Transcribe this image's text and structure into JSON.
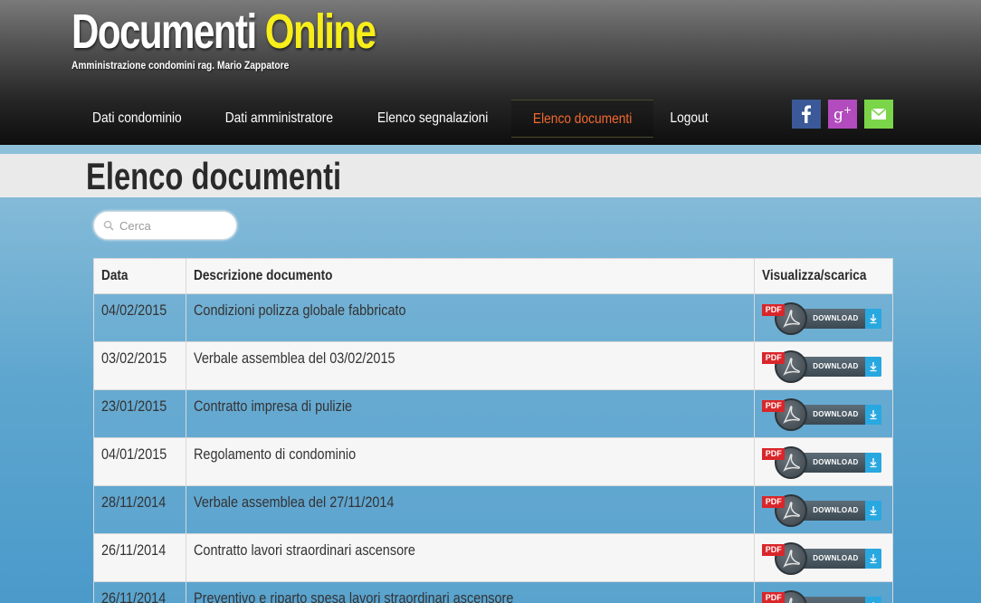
{
  "header": {
    "logo_main": "Documenti",
    "logo_accent": "Online",
    "tagline": "Amministrazione condomini rag. Mario Zappatore"
  },
  "nav": {
    "items": [
      {
        "label": "Dati condominio"
      },
      {
        "label": "Dati amministratore"
      },
      {
        "label": "Elenco segnalazioni"
      },
      {
        "label": "Elenco documenti",
        "active": true
      },
      {
        "label": "Logout"
      }
    ]
  },
  "social": {
    "icons": [
      "facebook-icon",
      "google-plus-icon",
      "mail-icon"
    ],
    "colors": {
      "facebook": "#3b5998",
      "google_plus": "#b24bbd",
      "mail": "#7bd548"
    }
  },
  "page": {
    "title": "Elenco documenti"
  },
  "search": {
    "placeholder": "Cerca",
    "value": ""
  },
  "table": {
    "headers": {
      "date": "Data",
      "description": "Descrizione documento",
      "download": "Visualizza/scarica"
    },
    "download_label": "DOWNLOAD",
    "pdf_label": "PDF",
    "rows": [
      {
        "date": "04/02/2015",
        "description": "Condizioni polizza globale fabbricato"
      },
      {
        "date": "03/02/2015",
        "description": "Verbale assemblea del 03/02/2015"
      },
      {
        "date": "23/01/2015",
        "description": "Contratto impresa di pulizie"
      },
      {
        "date": "04/01/2015",
        "description": "Regolamento di condominio"
      },
      {
        "date": "28/11/2014",
        "description": "Verbale assemblea del 27/11/2014"
      },
      {
        "date": "26/11/2014",
        "description": "Contratto lavori straordinari ascensore"
      },
      {
        "date": "26/11/2014",
        "description": "Preventivo e riparto spesa lavori straordinari ascensore"
      }
    ]
  },
  "colors": {
    "accent_yellow": "#f7ee1a",
    "active_nav": "#f26a2f",
    "download_arrow": "#29a8e0",
    "pdf_red": "#d9262a"
  }
}
